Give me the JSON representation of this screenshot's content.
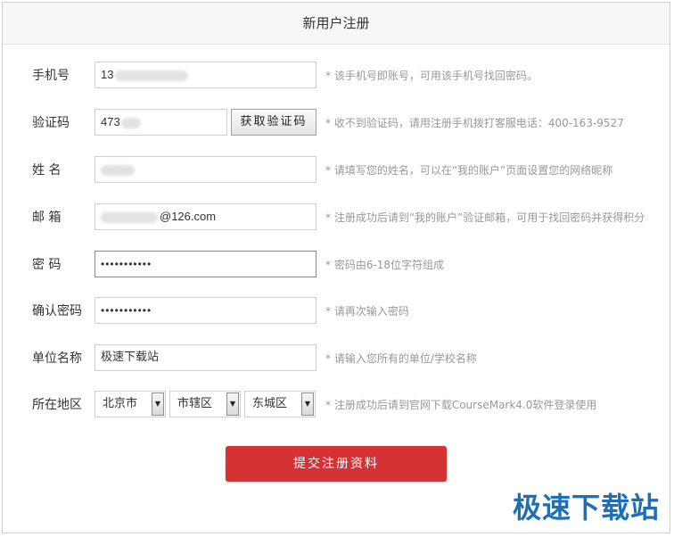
{
  "header": {
    "title": "新用户注册"
  },
  "form": {
    "phone": {
      "label": "手机号",
      "value": "13",
      "hint": "* 该手机号即账号，可用该手机号找回密码。"
    },
    "code": {
      "label": "验证码",
      "value": "473",
      "button": "获取验证码",
      "hint": "* 收不到验证码，请用注册手机拨打客服电话：400-163-9527"
    },
    "name": {
      "label": "姓 名",
      "hint": "* 请填写您的姓名，可以在“我的账户”页面设置您的网络昵称"
    },
    "email": {
      "label": "邮 箱",
      "value": "@126.com",
      "hint": "* 注册成功后请到“我的账户”验证邮箱，可用于找回密码并获得积分"
    },
    "password": {
      "label": "密 码",
      "value": "•••••••••••",
      "hint": "* 密码由6-18位字符组成"
    },
    "confirm": {
      "label": "确认密码",
      "value": "•••••••••••",
      "hint": "* 请再次输入密码"
    },
    "org": {
      "label": "单位名称",
      "value": "极速下载站",
      "hint": "* 请输入您所有的单位/学校名称"
    },
    "region": {
      "label": "所在地区",
      "province": "北京市",
      "city": "市辖区",
      "district": "东城区",
      "hint": "* 注册成功后请到官网下载CourseMark4.0软件登录使用"
    }
  },
  "submit_label": "提交注册资料",
  "watermark": "极速下载站",
  "colors": {
    "submit": "#d43233",
    "watermark": "#1d6fb8"
  }
}
